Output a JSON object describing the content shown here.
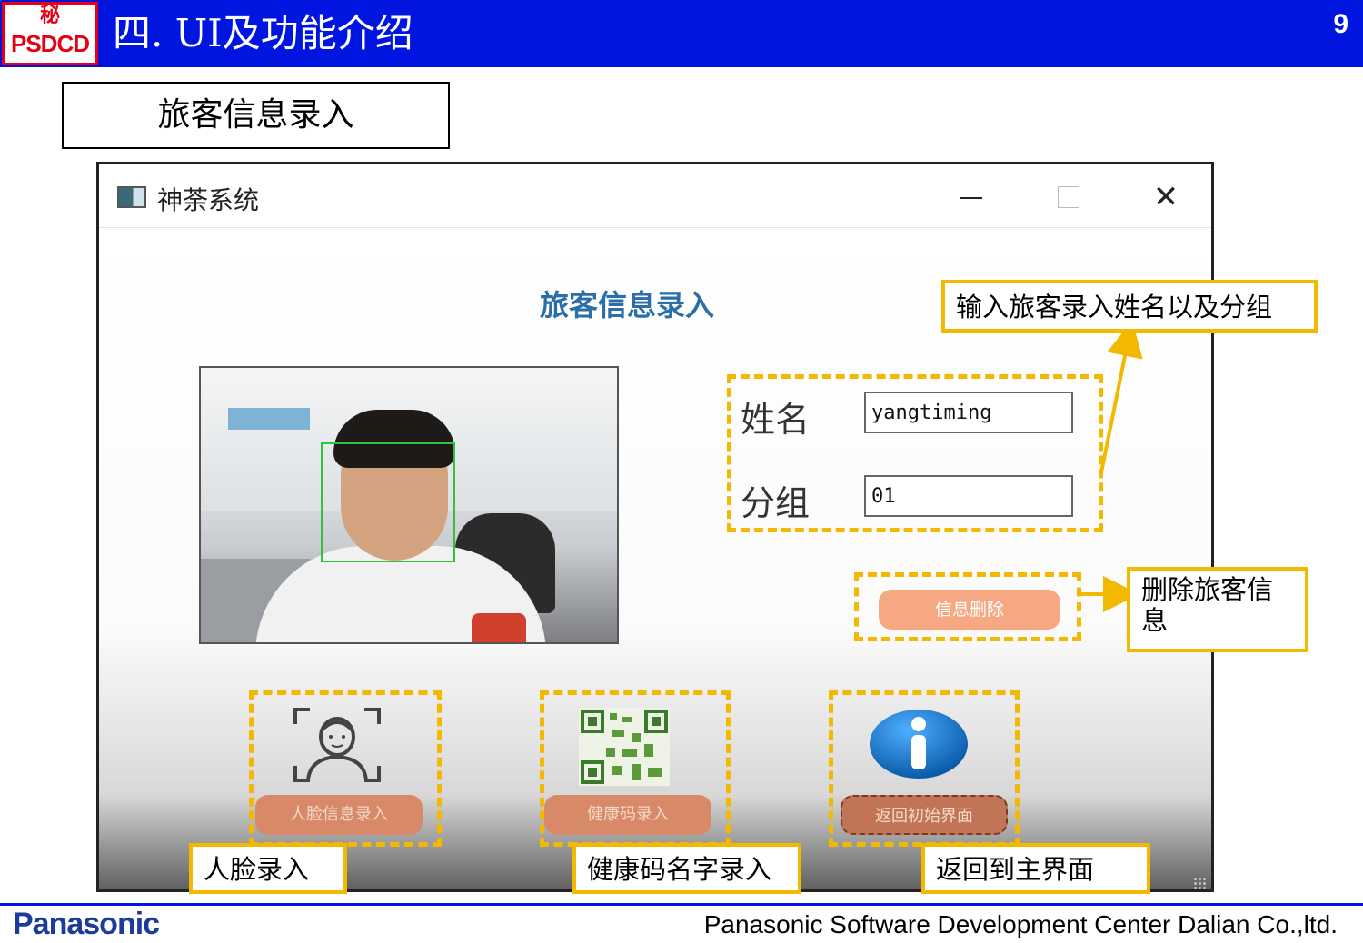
{
  "header": {
    "logo_top": "秘",
    "logo_bottom": "PSDCD",
    "title": "四. UI及功能介绍",
    "page_number": "9"
  },
  "section": {
    "label": "旅客信息录入"
  },
  "window": {
    "title": "神荼系统",
    "close_glyph": "✕",
    "heading": "旅客信息录入",
    "form": {
      "name_label": "姓名",
      "name_value": "yangtiming",
      "group_label": "分组",
      "group_value": "01"
    },
    "delete_button": "信息删除",
    "bottom_buttons": [
      {
        "label": "人脸信息录入",
        "icon": "face-scan-icon"
      },
      {
        "label": "健康码录入",
        "icon": "qr-code-icon"
      },
      {
        "label": "返回初始界面",
        "icon": "info-icon"
      }
    ]
  },
  "callouts": {
    "input_hint": "输入旅客录入姓名以及分组",
    "delete_hint": "删除旅客信息",
    "face_hint": "人脸录入",
    "health_hint": "健康码名字录入",
    "return_hint": "返回到主界面"
  },
  "colors": {
    "header_bg": "#0016e0",
    "logo_red": "#e60012",
    "annotation_yellow": "#f3b800",
    "heading_blue": "#2c6fa8",
    "button_salmon": "#f5a882",
    "face_box_green": "#2fc23a"
  },
  "footer": {
    "brand": "Panasonic",
    "company": "Panasonic Software Development Center Dalian Co.,ltd."
  }
}
